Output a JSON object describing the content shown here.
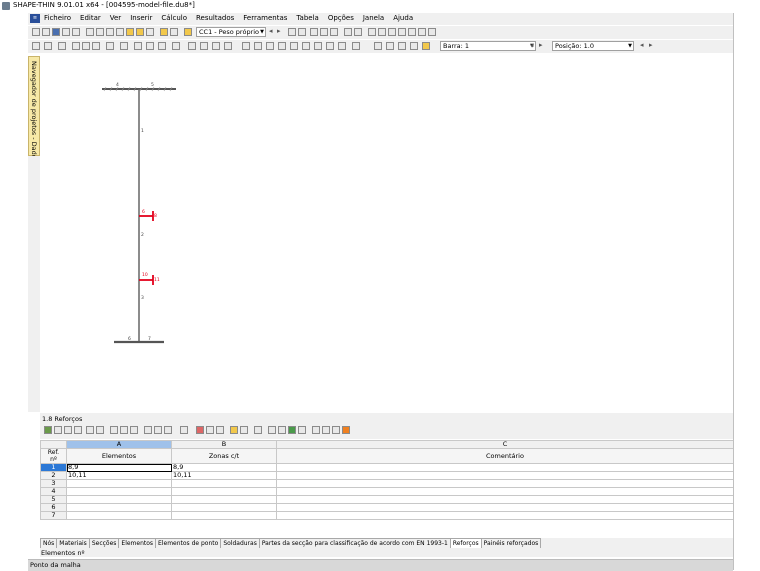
{
  "window": {
    "title": "SHAPE-THIN 9.01.01 x64 - [004595-model-file.du8*]"
  },
  "menu": {
    "items": [
      "Ficheiro",
      "Editar",
      "Ver",
      "Inserir",
      "Cálculo",
      "Resultados",
      "Ferramentas",
      "Tabela",
      "Opções",
      "Janela",
      "Ajuda"
    ]
  },
  "toolbar": {
    "loadcase": "CC1 - Peso próprio",
    "bar_label": "Barra: 1",
    "position_label": "Posição: 1.0"
  },
  "navigator": {
    "label": "Navegador de projetos - Dados"
  },
  "model": {
    "node_labels": [
      "4",
      "5",
      "1",
      "6",
      "8",
      "2",
      "10",
      "11",
      "3",
      "6",
      "7"
    ],
    "accent_color": "#e3001b"
  },
  "panel": {
    "title": "1.8 Reforços",
    "table": {
      "column_letters": [
        "A",
        "B",
        "C"
      ],
      "ref_header": [
        "Ref.",
        "nº"
      ],
      "headers": [
        "Elementos",
        "Zonas c/t",
        "Comentário"
      ],
      "rows": [
        {
          "n": "1",
          "elementos": "8,9",
          "zonas": "8,9",
          "comentario": ""
        },
        {
          "n": "2",
          "elementos": "10,11",
          "zonas": "10,11",
          "comentario": ""
        },
        {
          "n": "3",
          "elementos": "",
          "zonas": "",
          "comentario": ""
        },
        {
          "n": "4",
          "elementos": "",
          "zonas": "",
          "comentario": ""
        },
        {
          "n": "5",
          "elementos": "",
          "zonas": "",
          "comentario": ""
        },
        {
          "n": "6",
          "elementos": "",
          "zonas": "",
          "comentario": ""
        },
        {
          "n": "7",
          "elementos": "",
          "zonas": "",
          "comentario": ""
        }
      ]
    },
    "tabs": [
      "Nós",
      "Materiais",
      "Secções",
      "Elementos",
      "Elementos de ponto",
      "Soldaduras",
      "Partes da secção para classificação de acordo com EN 1993-1",
      "Reforços",
      "Painéis reforçados"
    ],
    "active_tab": "Reforços",
    "status_line": "Elementos nº"
  },
  "statusbar": {
    "text": "Ponto da malha"
  }
}
